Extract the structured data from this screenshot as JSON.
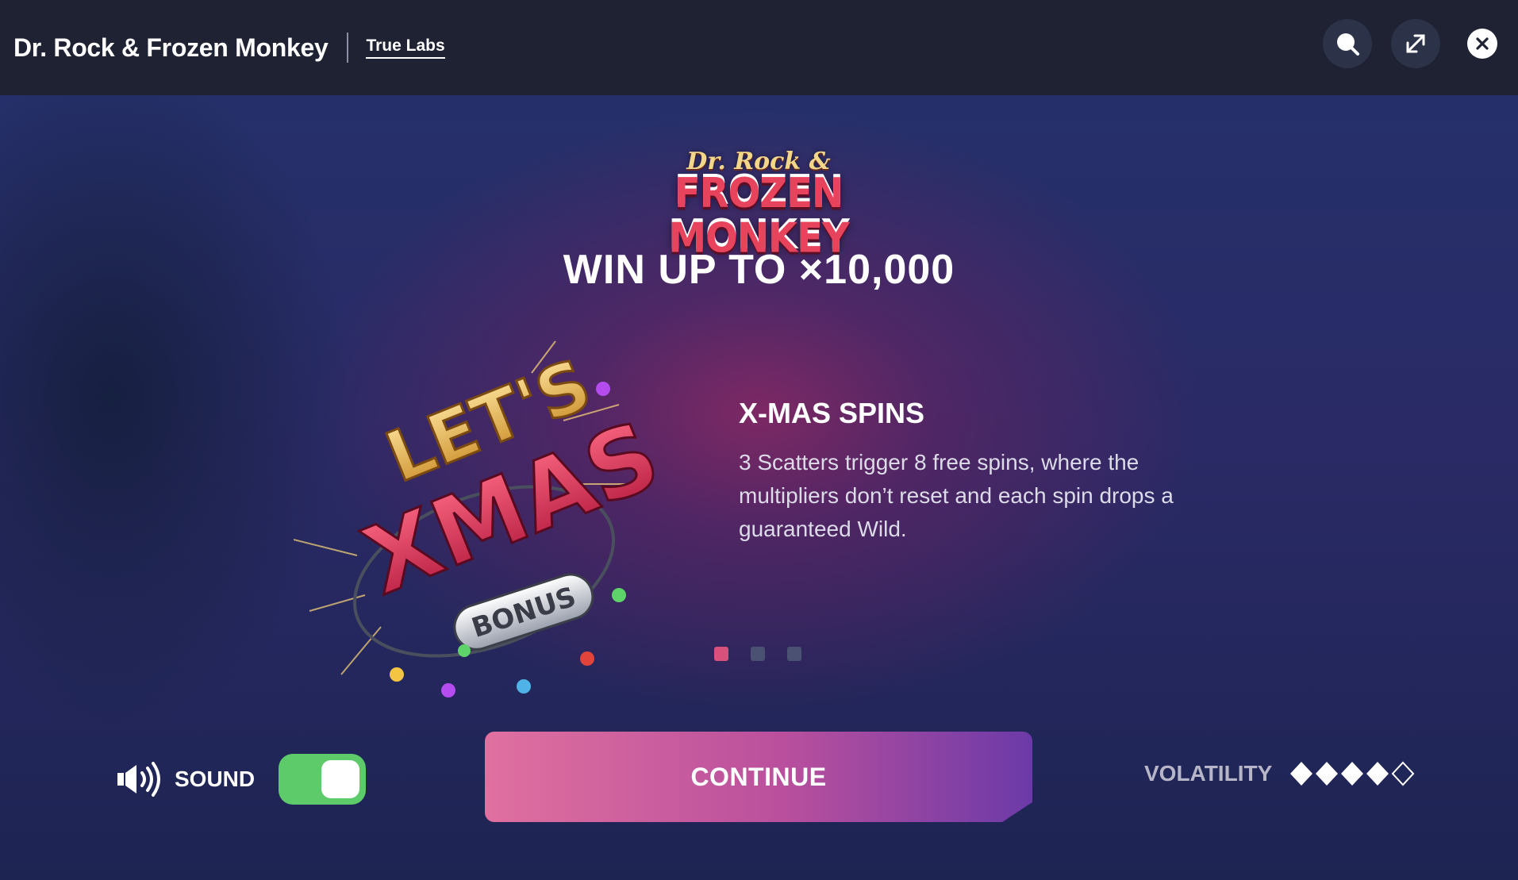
{
  "header": {
    "game_title": "Dr. Rock & Frozen Monkey",
    "provider": "True Labs",
    "icons": [
      "search-icon",
      "expand-icon",
      "close-icon"
    ]
  },
  "logo": {
    "line1": "Dr. Rock &",
    "line2": "FROZEN MONKEY"
  },
  "headline": "WIN UP TO ×10,000",
  "bonus_art": {
    "line1": "LET'S",
    "line2": "XMAS",
    "badge": "BONUS"
  },
  "feature": {
    "title": "X-MAS SPINS",
    "description": "3 Scatters trigger 8 free spins, where the multipliers don’t reset and each spin drops a guaranteed Wild."
  },
  "pagination": {
    "total": 3,
    "active": 1
  },
  "sound": {
    "label": "SOUND",
    "enabled": true
  },
  "continue_label": "CONTINUE",
  "volatility": {
    "label": "VOLATILITY",
    "level": 4,
    "max": 5
  },
  "colors": {
    "toggle_on": "#5ecb6a",
    "active_dot": "#d9507d",
    "button_start": "#e0709f",
    "button_end": "#6b3aa8"
  }
}
